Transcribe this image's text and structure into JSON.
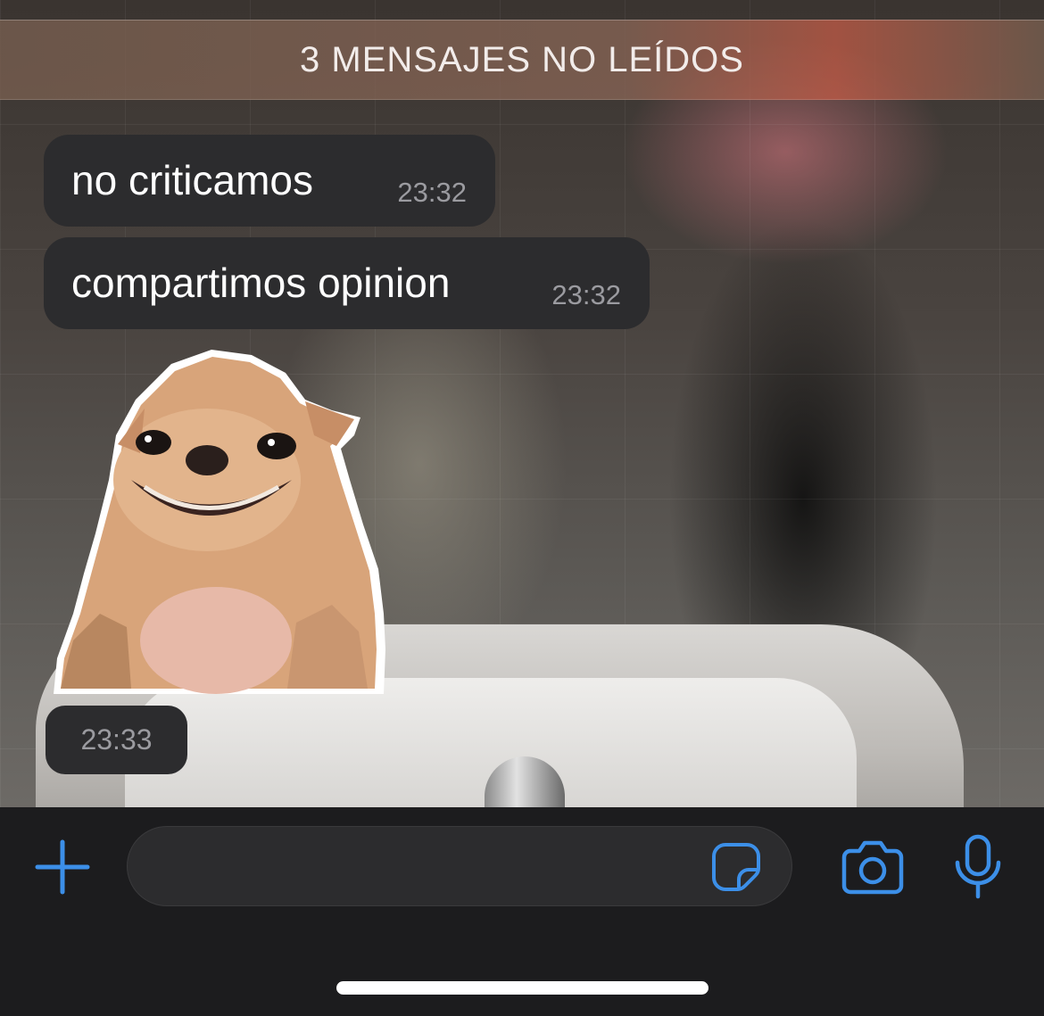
{
  "banner": {
    "unread_label": "3 MENSAJES NO LEÍDOS"
  },
  "messages": [
    {
      "text": "no criticamos",
      "time": "23:32"
    },
    {
      "text": "compartimos opinion",
      "time": "23:32"
    }
  ],
  "sticker": {
    "icon": "chihuahua-sticker",
    "time": "23:33"
  },
  "input": {
    "placeholder": "",
    "value": ""
  },
  "icons": {
    "plus": "plus-icon",
    "sticker": "sticker-icon",
    "camera": "camera-icon",
    "mic": "microphone-icon"
  },
  "colors": {
    "accent": "#3c8fe8",
    "bubble": "#2c2c2e",
    "input_bar": "#1c1c1e"
  }
}
